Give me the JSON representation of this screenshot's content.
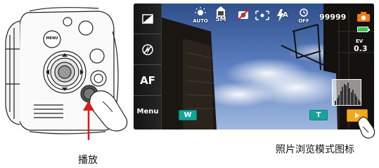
{
  "captions": {
    "play_label": "播放",
    "playback_icon_label": "照片浏览模式图标"
  },
  "camera": {
    "menu_button_label": "MENU"
  },
  "screen": {
    "left_buttons": {
      "af_label": "AF",
      "menu_label": "Menu"
    },
    "top_icons": {
      "scene_auto_label": "AUTO",
      "resolution_label": "5M",
      "flash_auto_label": "A",
      "self_timer_off_label": "OFF"
    },
    "shots_remaining": "99999",
    "ev_label": "EV",
    "ev_value": "0.3",
    "zoom_wide_label": "W",
    "zoom_tele_label": "T",
    "colors": {
      "zoom_button": "#16a39a",
      "playback_button": "#f2a91a",
      "camera_mode_icon": "#f07a14",
      "battery": "#3fbf4f"
    },
    "icons": [
      "frame-icon",
      "flash-off-icon",
      "scene-auto-icon",
      "resolution-icon",
      "stabilizer-off-icon",
      "focus-frame-icon",
      "flash-auto-icon",
      "self-timer-off-icon",
      "camera-mode-icon",
      "battery-icon",
      "histogram-icon",
      "playback-icon"
    ]
  }
}
